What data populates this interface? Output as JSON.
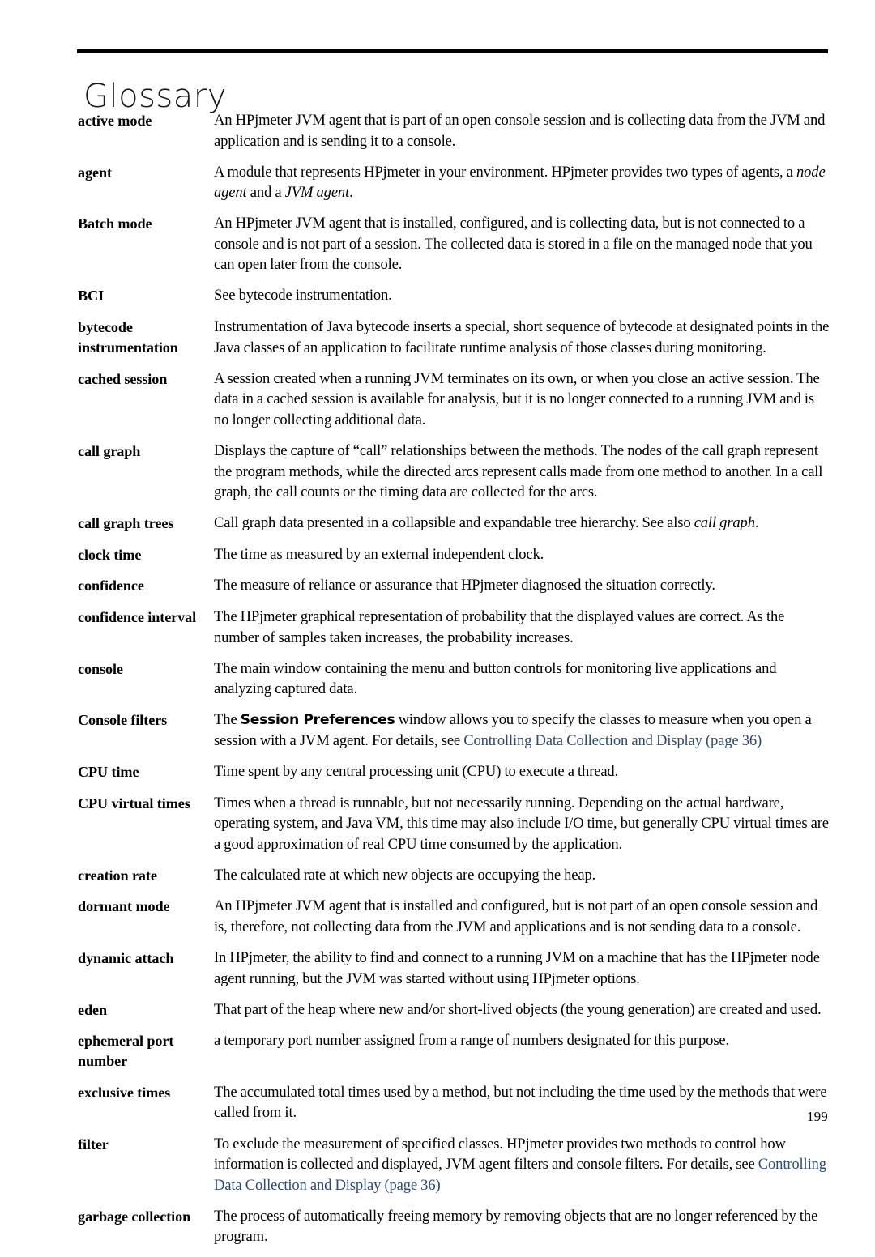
{
  "document": {
    "title": "Glossary",
    "page_number": "199",
    "link_color": "#2e4a73"
  },
  "entries": [
    {
      "term": "active mode",
      "definition": "An HPjmeter JVM agent that is part of an open console session and is collecting data from the JVM and application and is sending it to a console."
    },
    {
      "term": "agent",
      "definition": "A module that represents HPjmeter in your environment. HPjmeter provides two types of agents, a node agent and a JVM agent.",
      "parts": [
        {
          "text": "A module that represents HPjmeter in your environment. HPjmeter provides two types of agents, a ",
          "style": "normal"
        },
        {
          "text": "node agent",
          "style": "italic"
        },
        {
          "text": " and a ",
          "style": "normal"
        },
        {
          "text": "JVM agent",
          "style": "italic"
        },
        {
          "text": ".",
          "style": "normal"
        }
      ]
    },
    {
      "term": "Batch mode",
      "definition": "An HPjmeter JVM agent that is installed, configured, and is collecting data, but is not connected to a console and is not part of a session. The collected data is stored in a file on the managed node that you can open later from the console."
    },
    {
      "term": "BCI",
      "definition": "See bytecode instrumentation."
    },
    {
      "term": "bytecode instrumentation",
      "definition": "Instrumentation of Java bytecode inserts a special, short sequence of bytecode at designated points in the Java classes of an application to facilitate runtime analysis of those classes during monitoring."
    },
    {
      "term": "cached session",
      "definition": "A session created when a running JVM terminates on its own, or when you close an active session. The data in a cached session is available for analysis, but it is no longer connected to a running JVM and is no longer collecting additional data."
    },
    {
      "term": "call graph",
      "definition": "Displays the capture of “call” relationships between the methods. The nodes of the call graph represent the program methods, while the directed arcs represent calls made from one method to another. In a call graph, the call counts or the timing data are collected for the arcs."
    },
    {
      "term": "call graph trees",
      "definition": "Call graph data presented in a collapsible and expandable tree hierarchy. See also call graph.",
      "parts": [
        {
          "text": "Call graph data presented in a collapsible and expandable tree hierarchy. See also ",
          "style": "normal"
        },
        {
          "text": "call graph",
          "style": "italic"
        },
        {
          "text": ".",
          "style": "normal"
        }
      ]
    },
    {
      "term": "clock time",
      "definition": "The time as measured by an external independent clock."
    },
    {
      "term": "confidence",
      "definition": "The measure of reliance or assurance that HPjmeter diagnosed the situation correctly."
    },
    {
      "term": "confidence interval",
      "definition": "The HPjmeter graphical representation of probability that the displayed values are correct. As the number of samples taken increases, the probability increases."
    },
    {
      "term": "console",
      "definition": "The main window containing the menu and button controls for monitoring live applications and analyzing captured data."
    },
    {
      "term": "Console filters",
      "definition": "The Session Preferences window allows you to specify the classes to measure when you open a session with a JVM agent. For details, see Controlling Data Collection and Display (page 36)",
      "parts": [
        {
          "text": "The ",
          "style": "normal"
        },
        {
          "text": "Session Preferences",
          "style": "bold"
        },
        {
          "text": " window allows you to specify the classes to measure when you open a session with a JVM agent. For details, see ",
          "style": "normal"
        },
        {
          "text": "Controlling Data Collection and Display (page 36)",
          "style": "link"
        }
      ]
    },
    {
      "term": "CPU time",
      "definition": "Time spent by any central processing unit (CPU) to execute a thread."
    },
    {
      "term": "CPU virtual times",
      "definition": "Times when a thread is runnable, but not necessarily running. Depending on the actual hardware, operating system, and Java VM, this time may also include I/O time, but generally CPU virtual times are a good approximation of real CPU time consumed by the application."
    },
    {
      "term": "creation rate",
      "definition": "The calculated rate at which new objects are occupying the heap."
    },
    {
      "term": "dormant mode",
      "definition": "An HPjmeter JVM agent that is installed and configured, but is not part of an open console session and is, therefore, not collecting data from the JVM and applications and is not sending data to a console."
    },
    {
      "term": "dynamic attach",
      "definition": "In HPjmeter, the ability to find and connect to a running JVM on a machine that has the HPjmeter node agent running, but the JVM was started without using HPjmeter options."
    },
    {
      "term": "eden",
      "definition": "That part of the heap where new and/or short-lived objects (the young generation) are created and used."
    },
    {
      "term": "ephemeral port number",
      "definition": "a temporary port number assigned from a range of numbers designated for this purpose."
    },
    {
      "term": "exclusive times",
      "definition": "The accumulated total times used by a method, but not including the time used by the methods that were called from it."
    },
    {
      "term": "filter",
      "definition": "To exclude the measurement of specified classes. HPjmeter provides two methods to control how information is collected and displayed, JVM agent filters and console filters. For details, see Controlling Data Collection and Display (page 36)",
      "parts": [
        {
          "text": "To exclude the measurement of specified classes. HPjmeter provides two methods to control how information is collected and displayed, JVM agent filters and console filters. For details, see ",
          "style": "normal"
        },
        {
          "text": "Controlling Data Collection and Display (page 36)",
          "style": "link"
        }
      ]
    },
    {
      "term": "garbage collection",
      "definition": "The process of automatically freeing memory by removing objects that are no longer referenced by the program."
    }
  ]
}
